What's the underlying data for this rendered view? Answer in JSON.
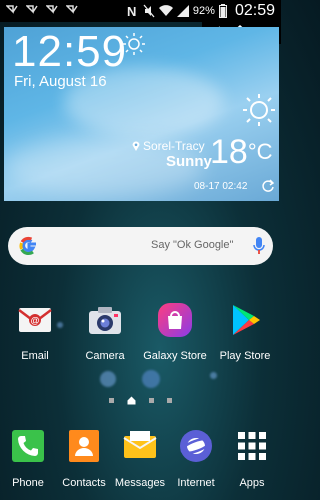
{
  "status_bar": {
    "battery_percent": "92%",
    "time": "02:59",
    "left_icons": [
      "notification-icon",
      "notification-icon",
      "notification-icon",
      "notification-icon"
    ],
    "right_icons": [
      "nfc-icon",
      "mute-icon",
      "wifi-icon",
      "signal-icon",
      "battery-icon"
    ]
  },
  "nav_overlay": {
    "icons": [
      "edit-icon",
      "home-icon",
      "back-icon"
    ]
  },
  "weather_widget": {
    "time": "12:59",
    "date": "Fri, August 16",
    "location": "Sorel-Tracy",
    "condition": "Sunny",
    "temperature": "18",
    "unit": "°C",
    "updated": "08-17 02:42"
  },
  "search": {
    "placeholder": "Say \"Ok Google\""
  },
  "home_apps": [
    {
      "label": "Email"
    },
    {
      "label": "Camera"
    },
    {
      "label": "Galaxy Store"
    },
    {
      "label": "Play Store"
    }
  ],
  "dock": [
    {
      "label": "Phone"
    },
    {
      "label": "Contacts"
    },
    {
      "label": "Messages"
    },
    {
      "label": "Internet"
    },
    {
      "label": "Apps"
    }
  ],
  "page_indicator": {
    "pages": 4,
    "current": 2
  },
  "colors": {
    "accent": "#1e88e5",
    "search_bg": "#f4f4f4"
  }
}
